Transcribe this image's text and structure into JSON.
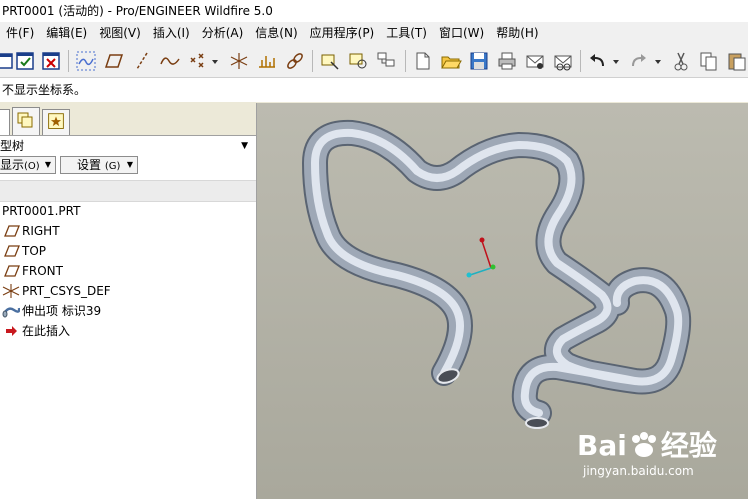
{
  "window": {
    "title": "PRT0001 (活动的) - Pro/ENGINEER Wildfire 5.0"
  },
  "menu": [
    "件(F)",
    "编辑(E)",
    "视图(V)",
    "插入(I)",
    "分析(A)",
    "信息(N)",
    "应用程序(P)",
    "工具(T)",
    "窗口(W)",
    "帮助(H)"
  ],
  "toolbar": {
    "icons": [
      "new-window-icon",
      "save-check-icon",
      "close-window-icon",
      "sketch-datum-icon",
      "datum-plane-icon",
      "datum-axis-icon",
      "datum-curve-icon",
      "datum-point-icon",
      "coordinate-system-icon",
      "analysis-icon",
      "chain-link-icon",
      "filter-select-icon",
      "model-tree-icon",
      "regenerate-icon",
      "new-file-icon",
      "open-file-icon",
      "save-icon",
      "print-icon",
      "email-icon",
      "copy-icon",
      "undo-icon",
      "redo-icon",
      "cut-icon",
      "paste-icon"
    ]
  },
  "message": "不显示坐标系。",
  "panel": {
    "tabs": [
      "model-tree-tab",
      "layers-tab",
      "favorites-tab"
    ],
    "title": "型树",
    "show_label": "显示",
    "show_shortcut": "(O)",
    "settings_label": "设置",
    "settings_shortcut": "(G)"
  },
  "tree": [
    {
      "label": "PRT0001.PRT",
      "icon": "part-icon"
    },
    {
      "label": "RIGHT",
      "icon": "datum-plane-icon"
    },
    {
      "label": "TOP",
      "icon": "datum-plane-icon"
    },
    {
      "label": "FRONT",
      "icon": "datum-plane-icon"
    },
    {
      "label": "PRT_CSYS_DEF",
      "icon": "coordinate-system-icon"
    },
    {
      "label": "伸出项 标识39",
      "icon": "sweep-feature-icon"
    },
    {
      "label": "在此插入",
      "icon": "insert-here-arrow-icon"
    }
  ],
  "watermark": {
    "brand": "Bai",
    "brand2": "经验",
    "url": "jingyan.baidu.com"
  }
}
